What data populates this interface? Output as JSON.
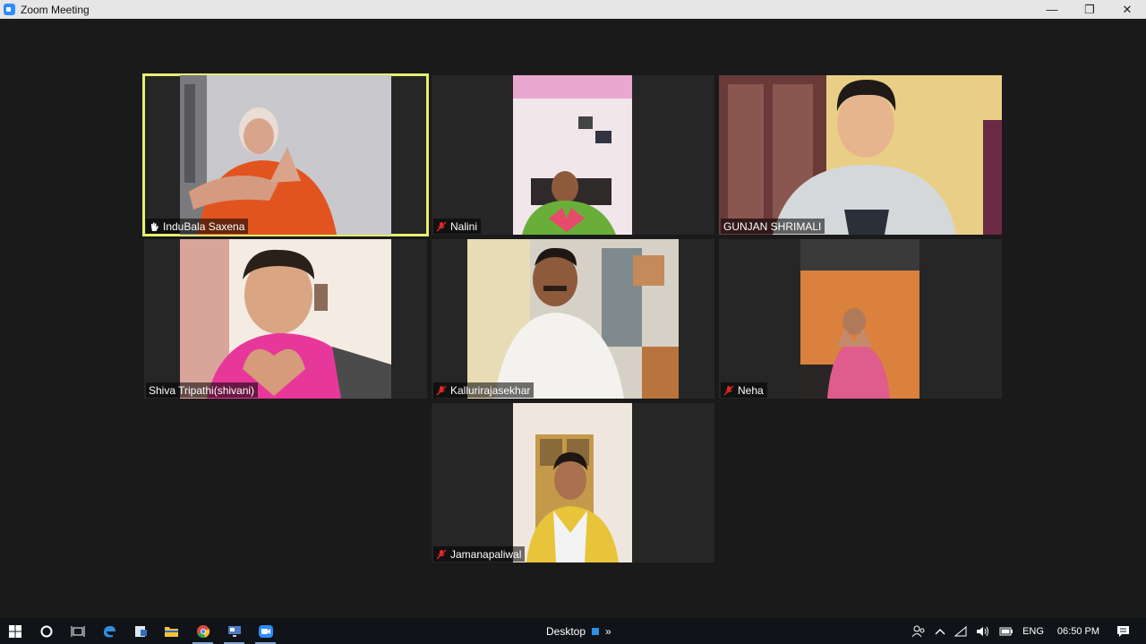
{
  "window": {
    "title": "Zoom Meeting"
  },
  "participants": [
    {
      "name": "InduBala Saxena",
      "icon": "hand-raised-icon"
    },
    {
      "name": "Nalini",
      "icon": "mic-muted-icon"
    },
    {
      "name": "GUNJAN SHRIMALI",
      "icon": ""
    },
    {
      "name": "Shiva Tripathi(shivani)",
      "icon": ""
    },
    {
      "name": "Kallurirajasekhar",
      "icon": "mic-muted-icon"
    },
    {
      "name": "Neha",
      "icon": "mic-muted-icon"
    },
    {
      "name": "Jamanapaliwal",
      "icon": "mic-muted-icon"
    }
  ],
  "active_speaker_color": "#e7f070",
  "mute_color": "#e02828",
  "taskbar": {
    "desktop_label": "Desktop",
    "overflow": "»",
    "language": "ENG",
    "time": "06:50 PM"
  }
}
